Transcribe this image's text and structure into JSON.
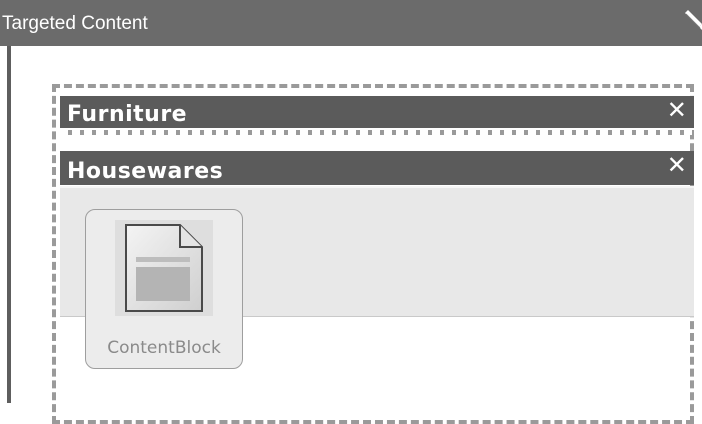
{
  "panel": {
    "title": "Targeted Content",
    "edit_icon": "pencil-icon"
  },
  "zones": [
    {
      "label": "Furniture",
      "close_glyph": "✕",
      "close_icon": "close-icon"
    },
    {
      "label": "Housewares",
      "close_glyph": "✕",
      "close_icon": "close-icon"
    }
  ],
  "items": [
    {
      "label": "ContentBlock",
      "icon": "document-icon"
    }
  ],
  "colors": {
    "header_bar": "#6b6b6b",
    "zone_header": "#5b5b5b",
    "drop_area": "#e8e8e8",
    "dashed_outline": "#9a9a9a"
  }
}
